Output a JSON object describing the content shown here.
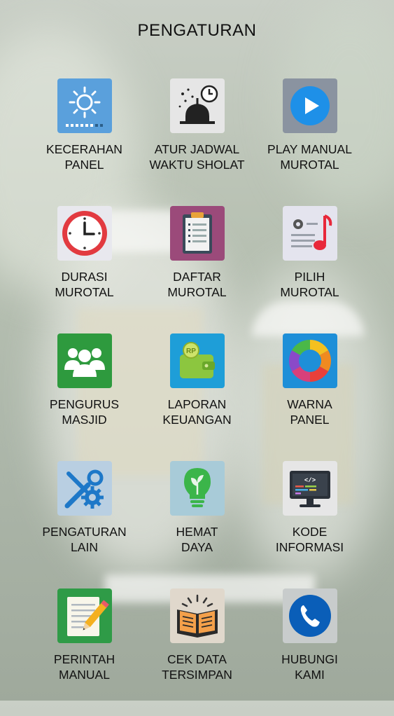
{
  "title": "PENGATURAN",
  "menu": [
    {
      "line1": "KECERAHAN",
      "line2": "PANEL",
      "icon": "brightness-icon",
      "color": "#5aa0dc"
    },
    {
      "line1": "ATUR JADWAL",
      "line2": "WAKTU SHOLAT",
      "icon": "mosque-clock-icon",
      "color": "#e6e6e6"
    },
    {
      "line1": "PLAY MANUAL",
      "line2": "MUROTAL",
      "icon": "play-icon",
      "color": "#8a93a0"
    },
    {
      "line1": "DURASI",
      "line2": "MUROTAL",
      "icon": "clock-icon",
      "color": "#e8e8ee"
    },
    {
      "line1": "DAFTAR",
      "line2": "MUROTAL",
      "icon": "clipboard-list-icon",
      "color": "#9b4a7a"
    },
    {
      "line1": "PILIH",
      "line2": "MUROTAL",
      "icon": "music-note-icon",
      "color": "#e4e4ee"
    },
    {
      "line1": "PENGURUS",
      "line2": "MASJID",
      "icon": "people-group-icon",
      "color": "#2e9a3e"
    },
    {
      "line1": "LAPORAN",
      "line2": "KEUANGAN",
      "icon": "wallet-icon",
      "color": "#1e9ed8"
    },
    {
      "line1": "WARNA",
      "line2": "PANEL",
      "icon": "color-wheel-icon",
      "color": "#1e8fd8"
    },
    {
      "line1": "PENGATURAN",
      "line2": "LAIN",
      "icon": "tools-gear-icon",
      "color": "#b9cfe2"
    },
    {
      "line1": "HEMAT",
      "line2": "DAYA",
      "icon": "eco-bulb-icon",
      "color": "#a8cbd8"
    },
    {
      "line1": "KODE",
      "line2": "INFORMASI",
      "icon": "code-monitor-icon",
      "color": "#e6e6e6"
    },
    {
      "line1": "PERINTAH",
      "line2": "MANUAL",
      "icon": "notepad-pencil-icon",
      "color": "#2f9b47"
    },
    {
      "line1": "CEK DATA",
      "line2": "TERSIMPAN",
      "icon": "open-book-icon",
      "color": "#e0d8cc"
    },
    {
      "line1": "HUBUNGI",
      "line2": "KAMI",
      "icon": "phone-icon",
      "color": "#c8cccc"
    }
  ]
}
